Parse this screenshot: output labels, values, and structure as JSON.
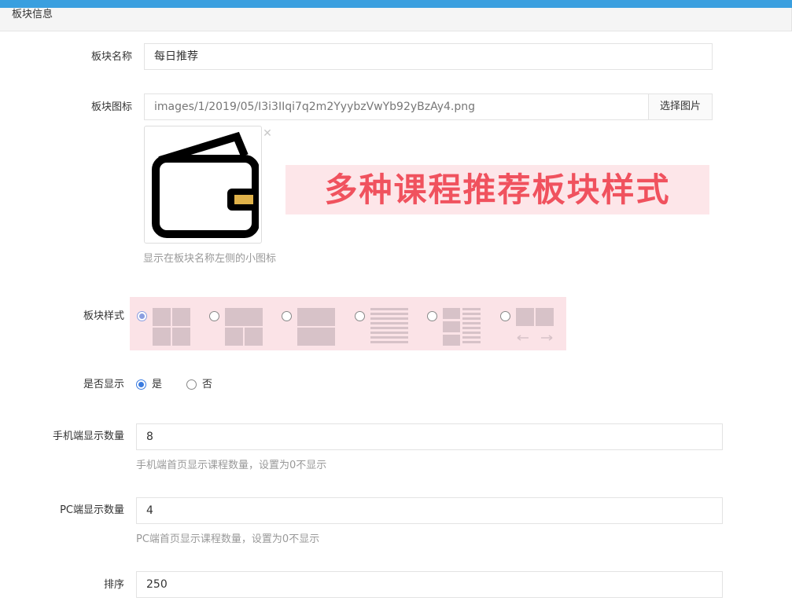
{
  "section": {
    "title": "板块信息"
  },
  "form": {
    "block_name": {
      "label": "板块名称",
      "value": "每日推荐"
    },
    "block_icon": {
      "label": "板块图标",
      "value": "images/1/2019/05/I3i3IIqi7q2m2YyybzVwYb92yBzAy4.png",
      "button": "选择图片",
      "help": "显示在板块名称左侧的小图标",
      "remove_glyph": "✕",
      "image_icon": "wallet-icon"
    },
    "banner_text": "多种课程推荐板块样式",
    "block_style": {
      "label": "板块样式",
      "selected_index": 0,
      "options": [
        "grid-2x2",
        "banner-over-2",
        "two-wide-rows",
        "text-list",
        "grid-with-list",
        "swipe-2"
      ]
    },
    "show": {
      "label": "是否显示",
      "options": [
        "是",
        "否"
      ],
      "selected": "是"
    },
    "mobile_count": {
      "label": "手机端显示数量",
      "value": "8",
      "help": "手机端首页显示课程数量，设置为0不显示"
    },
    "pc_count": {
      "label": "PC端显示数量",
      "value": "4",
      "help": "PC端首页显示课程数量，设置为0不显示"
    },
    "sort": {
      "label": "排序",
      "value": "250"
    }
  },
  "colors": {
    "accent": "#3a9fdf",
    "radio": "#3a7be0",
    "banner_text": "#f0525e",
    "banner_bg": "#fde6e9",
    "layout_block": "#d7c2c8"
  }
}
